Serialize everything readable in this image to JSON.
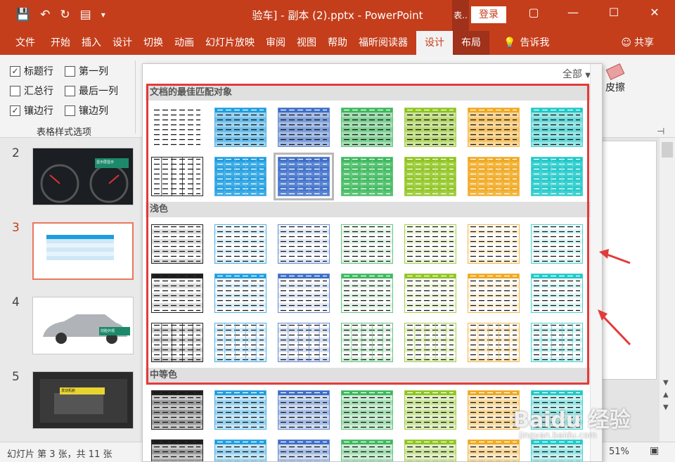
{
  "titlebar": {
    "title": "验车] - 副本 (2).pptx  -  PowerPoint",
    "context_tab": "表..",
    "login": "登录"
  },
  "menu": {
    "items": [
      "文件",
      "开始",
      "插入",
      "设计",
      "切换",
      "动画",
      "幻灯片放映",
      "审阅",
      "视图",
      "帮助",
      "福昕阅读器"
    ],
    "design_tab": "设计",
    "layout_tab": "布局",
    "tell_me": "告诉我",
    "share": "共享"
  },
  "ribbon": {
    "options": [
      {
        "label": "标题行",
        "checked": true
      },
      {
        "label": "第一列",
        "checked": false
      },
      {
        "label": "汇总行",
        "checked": false
      },
      {
        "label": "最后一列",
        "checked": false
      },
      {
        "label": "镶边行",
        "checked": true
      },
      {
        "label": "镶边列",
        "checked": false
      }
    ],
    "group_label": "表格样式选项",
    "eraser_label": "皮擦"
  },
  "slides": [
    {
      "number": "2",
      "label_text": "显示屏显示"
    },
    {
      "number": "3",
      "label_text": ""
    },
    {
      "number": "4",
      "label_text": "前脸外观"
    },
    {
      "number": "5",
      "label_text": "发动机舱"
    }
  ],
  "gallery": {
    "filter": "全部",
    "sections": [
      "文档的最佳匹配对象",
      "浅色",
      "中等色"
    ],
    "colors": [
      "#ffffff",
      "#1e9de0",
      "#3c6ec8",
      "#3cb85c",
      "#8ec41e",
      "#f0a81e",
      "#1ec8c8"
    ]
  },
  "statusbar": {
    "slide_info": "幻灯片 第 3 张，共 11 张",
    "zoom": "51%"
  },
  "watermark": {
    "brand": "Baidu 经验",
    "url": "jingyan.baidu.com"
  }
}
